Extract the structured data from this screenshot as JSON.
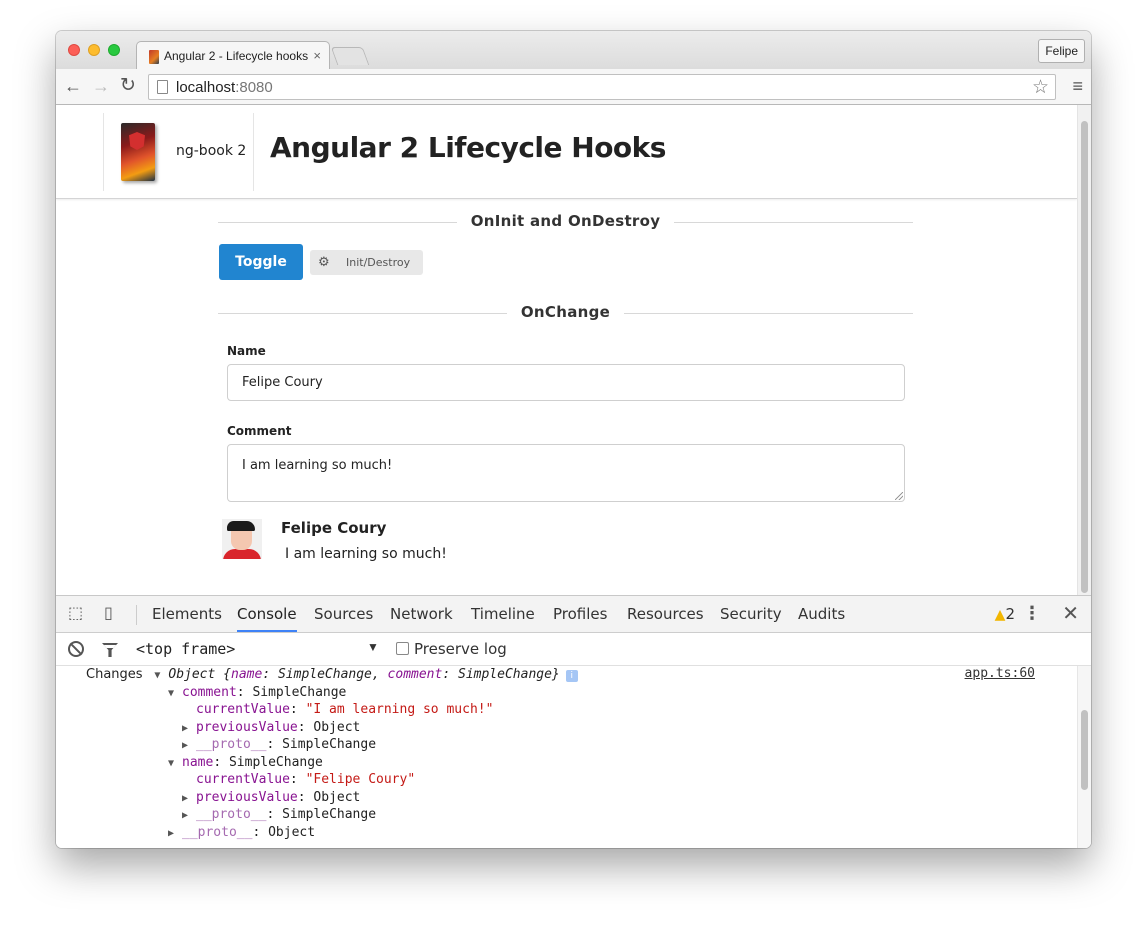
{
  "browser": {
    "tab_title": "Angular 2 - Lifecycle hooks",
    "tab_close": "×",
    "profile_label": "Felipe",
    "url_host": "localhost",
    "url_port": ":8080",
    "back_glyph": "←",
    "forward_glyph": "→",
    "reload_glyph": "↻",
    "star_glyph": "☆",
    "menu_glyph": "≡"
  },
  "page": {
    "brand_name": "ng-book 2",
    "title": "Angular 2 Lifecycle Hooks",
    "section1": "OnInit and OnDestroy",
    "toggle_label": "Toggle",
    "init_destroy_label": "Init/Destroy",
    "section2": "OnChange",
    "name_label": "Name",
    "name_value": "Felipe Coury",
    "comment_label": "Comment",
    "comment_value": "I am learning so much!",
    "comment_author": "Felipe Coury",
    "comment_text": "I am learning so much!"
  },
  "devtools": {
    "tabs": [
      "Elements",
      "Console",
      "Sources",
      "Network",
      "Timeline",
      "Profiles",
      "Resources",
      "Security",
      "Audits"
    ],
    "active_tab": "Console",
    "warning_count": "2",
    "frame_select": "<top frame>",
    "preserve_log_label": "Preserve log",
    "close_glyph": "✕",
    "kebab_glyph": "⋮",
    "source_link": "app.ts:60",
    "log": {
      "prefix": "Changes",
      "object_head": "Object {",
      "k_name": "name",
      "v_simple": "SimpleChange",
      "k_comment": "comment",
      "object_tail": "}",
      "info": "i",
      "comment_key": "comment",
      "comment_type": "SimpleChange",
      "current_value_key": "currentValue",
      "comment_current": "\"I am learning so much!\"",
      "previous_value_key": "previousValue",
      "object_type": "Object",
      "proto_key": "__proto__",
      "simplechange_type": "SimpleChange",
      "name_key": "name",
      "name_type": "SimpleChange",
      "name_current": "\"Felipe Coury\""
    }
  },
  "colors": {
    "primary_button": "#2185d0",
    "console_key": "#881391",
    "console_string": "#c41a16",
    "active_tab_underline": "#3e82f7"
  }
}
